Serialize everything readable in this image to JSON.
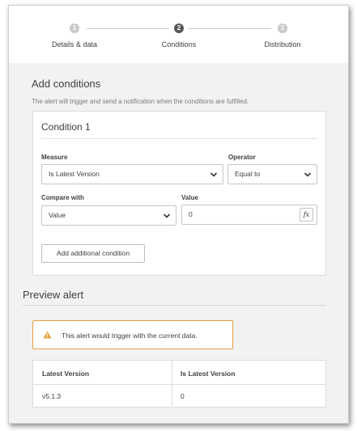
{
  "stepper": {
    "steps": [
      {
        "number": "1",
        "label": "Details & data",
        "state": "complete"
      },
      {
        "number": "2",
        "label": "Conditions",
        "state": "active"
      },
      {
        "number": "3",
        "label": "Distribution",
        "state": "upcoming"
      }
    ]
  },
  "conditions": {
    "title": "Add conditions",
    "description": "The alert will trigger and send a notification when the conditions are fulfilled."
  },
  "condition_card": {
    "title": "Condition 1",
    "measure_label": "Measure",
    "measure_value": "Is Latest Version",
    "operator_label": "Operator",
    "operator_value": "Equal to",
    "compare_label": "Compare with",
    "compare_value": "Value",
    "value_label": "Value",
    "value_input": "0",
    "fx_label": "fx",
    "add_condition_label": "Add additional condition"
  },
  "preview": {
    "title": "Preview alert",
    "warning": "This alert would trigger with the current data.",
    "table": {
      "columns": [
        "Latest Version",
        "Is Latest Version"
      ],
      "rows": [
        [
          "v5.1.3",
          "0"
        ]
      ]
    }
  },
  "colors": {
    "warning_border": "#e0a13f",
    "warning_icon": "#e8a33d",
    "step_active": "#595959",
    "step_inactive": "#c9c9c9"
  }
}
